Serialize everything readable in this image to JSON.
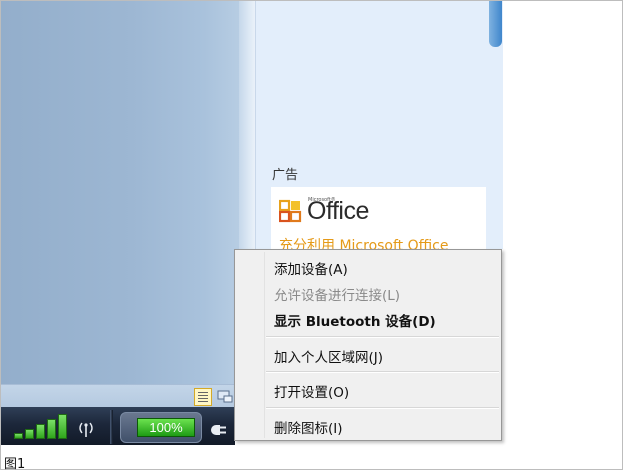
{
  "ad": {
    "label": "广告",
    "office_brand": "Office",
    "office_microsoft": "Microsoft®",
    "office_tagline": "充分利用 Microsoft Office"
  },
  "tray": {
    "battery_percent": "100%",
    "battery_level": 1.0,
    "signal_bars": 5
  },
  "context_menu": {
    "items": [
      {
        "label": "添加设备(A)",
        "enabled": true,
        "bold": false
      },
      {
        "label": "允许设备进行连接(L)",
        "enabled": false,
        "bold": false
      },
      {
        "label": "显示 Bluetooth 设备(D)",
        "enabled": true,
        "bold": true
      },
      {
        "label": "加入个人区域网(J)",
        "enabled": true,
        "bold": false
      },
      {
        "label": "打开设置(O)",
        "enabled": true,
        "bold": false
      },
      {
        "label": "删除图标(I)",
        "enabled": true,
        "bold": false
      }
    ]
  },
  "caption": "图1",
  "colors": {
    "desktop_blue": "#9db7d3",
    "office_orange": "#e59a18",
    "battery_green": "#2fa51c"
  }
}
